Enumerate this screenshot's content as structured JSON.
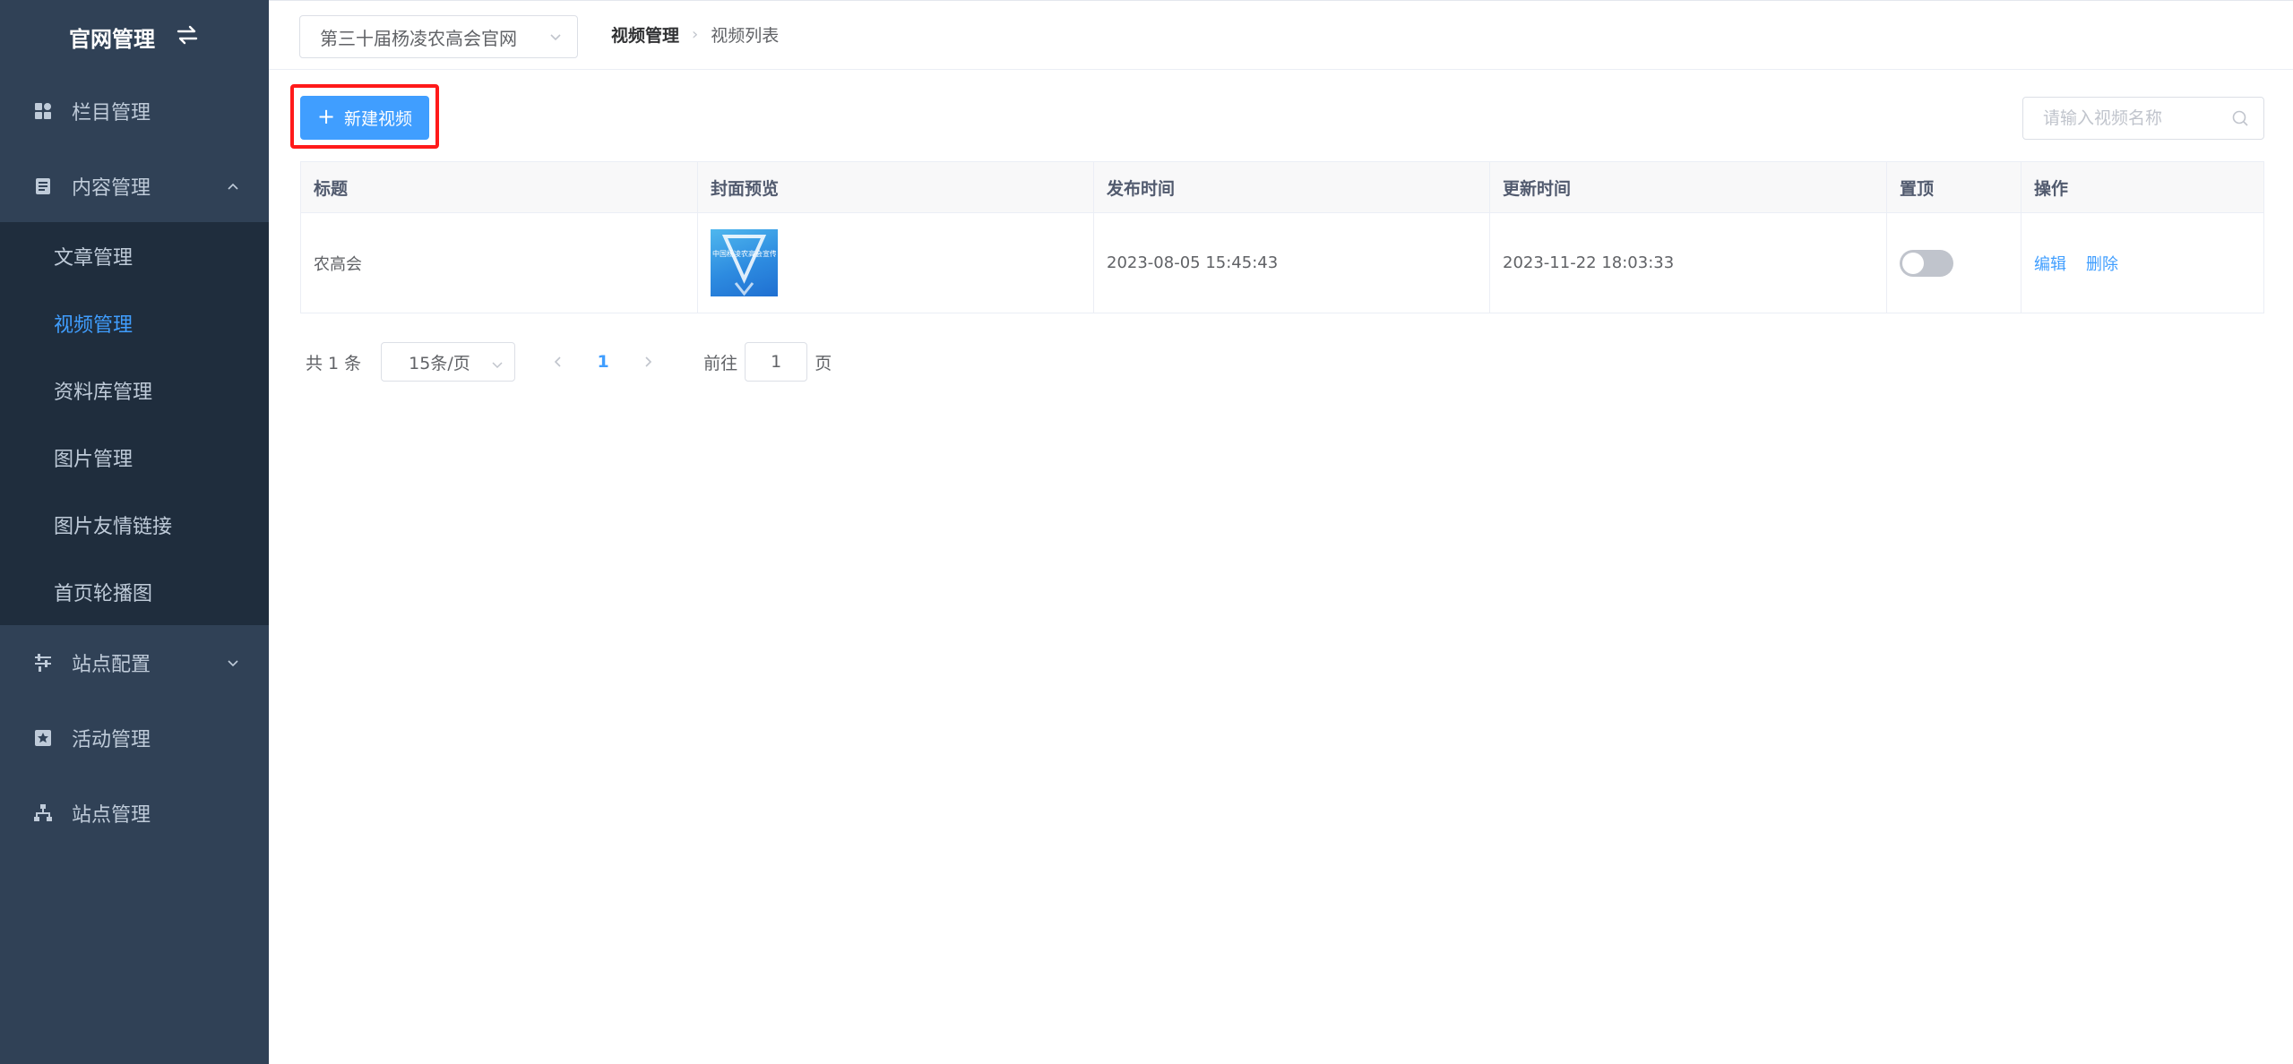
{
  "sidebar": {
    "title": "官网管理",
    "items": [
      {
        "label": "栏目管理",
        "icon": "grid-icon"
      },
      {
        "label": "内容管理",
        "icon": "document-icon",
        "expanded": true,
        "children": [
          {
            "label": "文章管理"
          },
          {
            "label": "视频管理",
            "active": true
          },
          {
            "label": "资料库管理"
          },
          {
            "label": "图片管理"
          },
          {
            "label": "图片友情链接"
          },
          {
            "label": "首页轮播图"
          }
        ]
      },
      {
        "label": "站点配置",
        "icon": "sliders-icon"
      },
      {
        "label": "活动管理",
        "icon": "star-box-icon"
      },
      {
        "label": "站点管理",
        "icon": "sitemap-icon"
      }
    ]
  },
  "header": {
    "site_select": "第三十届杨凌农高会官网",
    "breadcrumb": [
      "视频管理",
      "视频列表"
    ]
  },
  "toolbar": {
    "new_button": "新建视频",
    "search_placeholder": "请输入视频名称"
  },
  "table": {
    "columns": [
      "标题",
      "封面预览",
      "发布时间",
      "更新时间",
      "置顶",
      "操作"
    ],
    "rows": [
      {
        "title": "农高会",
        "cover_text": "中国杨凌农高会宣传片",
        "published": "2023-08-05 15:45:43",
        "updated": "2023-11-22 18:03:33",
        "pinned": false,
        "actions": [
          "编辑",
          "删除"
        ]
      }
    ]
  },
  "pagination": {
    "total": "共 1 条",
    "page_size": "15条/页",
    "current_page": "1",
    "goto_prefix": "前往",
    "goto_value": "1",
    "goto_suffix": "页"
  },
  "colors": {
    "sidebar_bg": "#304156",
    "submenu_bg": "#1f2d3d",
    "primary": "#409eff",
    "highlight": "#ff1a1a"
  }
}
